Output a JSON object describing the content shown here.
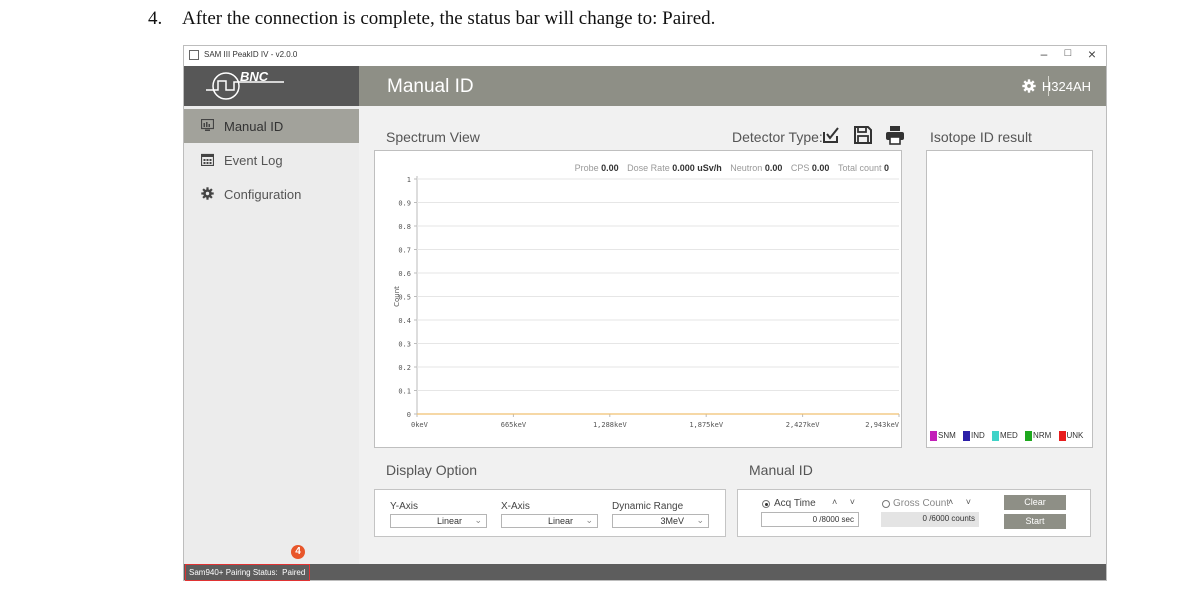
{
  "doc": {
    "step_number": "4.",
    "step_text": "After the connection is complete, the status bar will change to: Paired."
  },
  "window": {
    "title": "SAM III PeakID IV - v2.0.0",
    "minimize": "–",
    "maximize": "□",
    "close": "×"
  },
  "logo_text": "BNC",
  "sidebar": {
    "items": [
      {
        "label": "Manual ID",
        "icon": "monitor-icon",
        "active": true
      },
      {
        "label": "Event Log",
        "icon": "calendar-icon",
        "active": false
      },
      {
        "label": "Configuration",
        "icon": "gear-icon",
        "active": false
      }
    ]
  },
  "header": {
    "title": "Manual ID",
    "device_id": "H324AH",
    "settings_icon": "gear-icon"
  },
  "spectrum": {
    "title": "Spectrum View",
    "detector_label": "Detector Type:",
    "detector_icons": [
      "checklist-icon",
      "save-icon",
      "print-icon"
    ],
    "stats": [
      {
        "label": "Probe",
        "value": "0.00"
      },
      {
        "label": "Dose Rate",
        "value": "0.000 uSv/h"
      },
      {
        "label": "Neutron",
        "value": "0.00"
      },
      {
        "label": "CPS",
        "value": "0.00"
      },
      {
        "label": "Total count",
        "value": "0"
      }
    ]
  },
  "chart_data": {
    "type": "line",
    "title": "",
    "xlabel": "",
    "ylabel": "Count",
    "x_ticks": [
      "0keV",
      "665keV",
      "1,288keV",
      "1,875keV",
      "2,427keV",
      "2,943keV"
    ],
    "y_ticks": [
      0,
      0.1,
      0.2,
      0.3,
      0.4,
      0.5,
      0.6,
      0.7,
      0.8,
      0.9,
      1
    ],
    "y_tick_labels": [
      "0",
      "0.1",
      "0.2",
      "0.3",
      "0.4",
      "0.5",
      "0.6",
      "0.7",
      "0.8",
      "0.9",
      "1"
    ],
    "ylim": [
      0,
      1
    ],
    "grid": true,
    "series": [
      {
        "values": [
          0,
          0,
          0,
          0,
          0,
          0
        ],
        "color": "#f0c070"
      }
    ]
  },
  "isotope": {
    "title": "Isotope ID result",
    "legend": [
      {
        "label": "SNM",
        "color": "#c21fb8"
      },
      {
        "label": "IND",
        "color": "#2b1fa8"
      },
      {
        "label": "MED",
        "color": "#3fd3c8"
      },
      {
        "label": "NRM",
        "color": "#1ea81e"
      },
      {
        "label": "UNK",
        "color": "#e81c1c"
      }
    ]
  },
  "display_option": {
    "title": "Display Option",
    "y_axis": {
      "label": "Y-Axis",
      "value": "Linear"
    },
    "x_axis": {
      "label": "X-Axis",
      "value": "Linear"
    },
    "dynamic_range": {
      "label": "Dynamic Range",
      "value": "3MeV"
    }
  },
  "manual_id": {
    "title": "Manual ID",
    "acq_time": {
      "label": "Acq Time",
      "value": "0 /8000 sec",
      "selected": true
    },
    "gross_count": {
      "label": "Gross Count",
      "value": "0 /6000 counts",
      "selected": false
    },
    "updown": "˄ ˅",
    "clear_label": "Clear",
    "start_label": "Start"
  },
  "status": {
    "label": "Sam940+ Pairing Status:",
    "value": "Paired",
    "callout_number": "4"
  }
}
